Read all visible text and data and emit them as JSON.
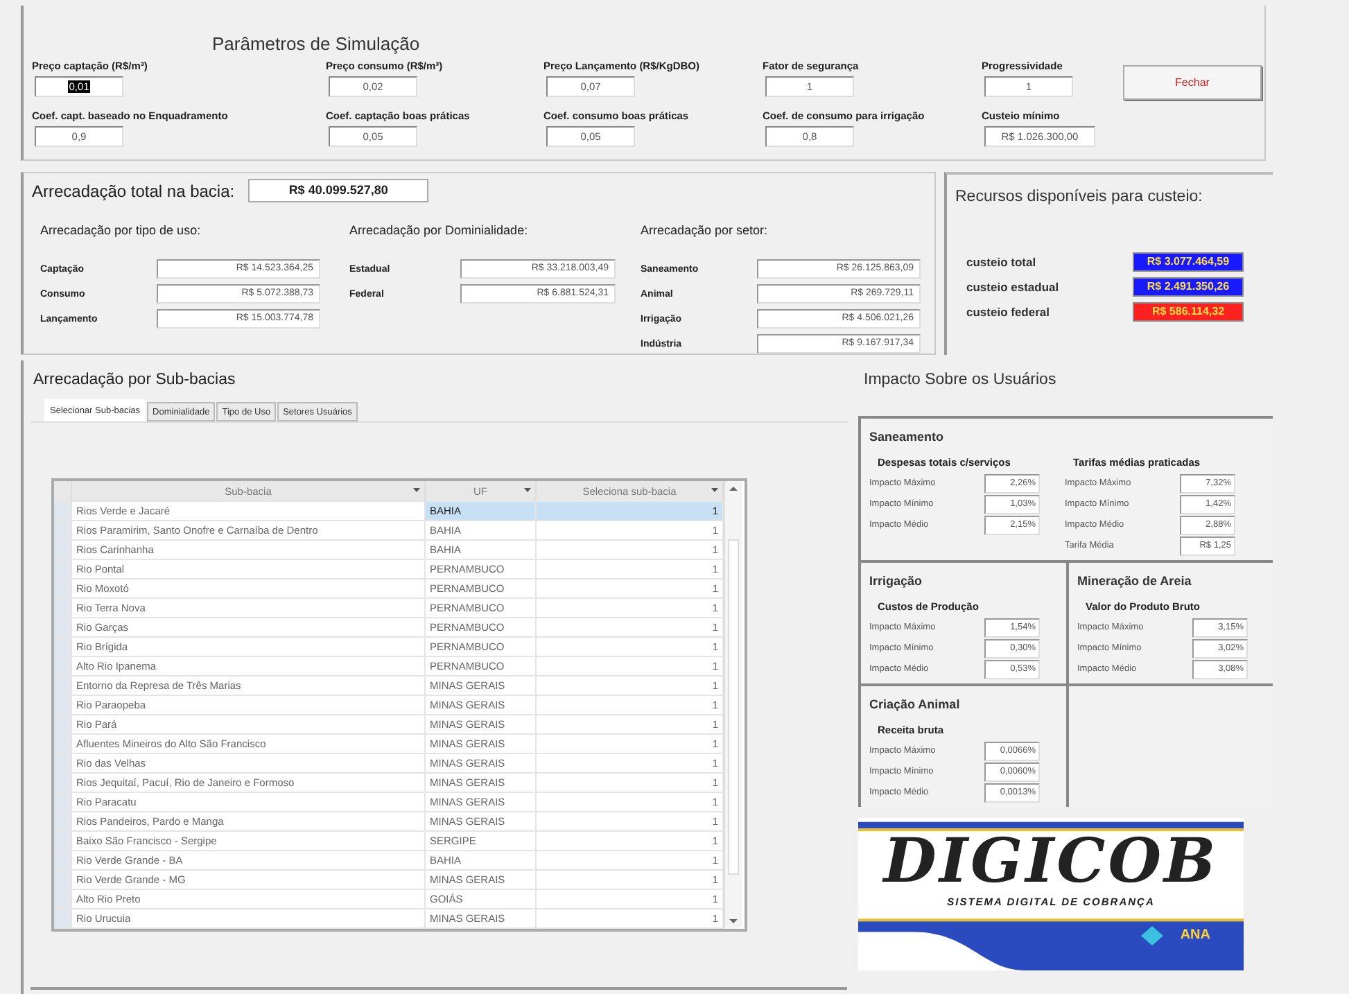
{
  "window": {
    "title": "Parâmetros de Simulação"
  },
  "parameters": [
    {
      "label": "Preço captação (R$/m³)",
      "value": "0,01",
      "highlighted": true
    },
    {
      "label": "Preço consumo (R$/m³)",
      "value": "0,02",
      "highlighted": false
    },
    {
      "label": "Preço Lançamento (R$/KgDBO)",
      "value": "0,07",
      "highlighted": false
    },
    {
      "label": "Fator de segurança",
      "value": "1",
      "highlighted": false
    },
    {
      "label": "Progressividade",
      "value": "1",
      "highlighted": false
    },
    {
      "label": "Coef. capt. baseado no Enquadramento",
      "value": "0,9",
      "highlighted": false
    },
    {
      "label": "Coef. captação boas práticas",
      "value": "0,05",
      "highlighted": false
    },
    {
      "label": "Coef. consumo boas práticas",
      "value": "0,05",
      "highlighted": false
    },
    {
      "label": "Coef. de consumo para irrigação",
      "value": "0,8",
      "highlighted": false
    },
    {
      "label": "Custeio mínimo",
      "value": "R$ 1.026.300,00",
      "highlighted": false
    }
  ],
  "close_button": "Fechar",
  "total": {
    "label": "Arrecadação total na bacia:",
    "value": "R$ 40.099.527,80"
  },
  "groups": [
    {
      "title": "Arrecadação por tipo de uso:",
      "items": [
        {
          "label": "Captação",
          "value": "R$ 14.523.364,25"
        },
        {
          "label": "Consumo",
          "value": "R$ 5.072.388,73"
        },
        {
          "label": "Lançamento",
          "value": "R$ 15.003.774,78"
        }
      ]
    },
    {
      "title": "Arrecadação por Dominialidade:",
      "items": [
        {
          "label": "Estadual",
          "value": "R$ 33.218.003,49"
        },
        {
          "label": "Federal",
          "value": "R$ 6.881.524,31"
        }
      ]
    },
    {
      "title": "Arrecadação por setor:",
      "items": [
        {
          "label": "Saneamento",
          "value": "R$ 26.125.863,09"
        },
        {
          "label": "Animal",
          "value": "R$ 269.729,11"
        },
        {
          "label": "Irrigação",
          "value": "R$ 4.506.021,26"
        },
        {
          "label": "Indústria",
          "value": "R$ 9.167.917,34"
        }
      ]
    }
  ],
  "resources": {
    "title": "Recursos disponíveis para custeio:",
    "items": [
      {
        "label": "custeio total",
        "value": "R$ 3.077.464,59",
        "color": "#1a1aff"
      },
      {
        "label": "custeio estadual",
        "value": "R$ 2.491.350,26",
        "color": "#1a1aff"
      },
      {
        "label": "custeio federal",
        "value": "R$ 586.114,32",
        "color": "#ff2020"
      }
    ]
  },
  "subbasins": {
    "title": "Arrecadação por Sub-bacias",
    "tabs": [
      {
        "label": "Selecionar Sub-bacias",
        "selected": true
      },
      {
        "label": "Dominialidade",
        "selected": false
      },
      {
        "label": "Tipo de Uso",
        "selected": false
      },
      {
        "label": "Setores Usuários",
        "selected": false
      }
    ],
    "columns": [
      "Sub-bacia",
      "UF",
      "Seleciona sub-bacia"
    ],
    "rows": [
      {
        "cells": [
          "Rios Verde e Jacaré",
          "BAHIA",
          "1"
        ],
        "selected": true
      },
      {
        "cells": [
          "Rios Paramirim, Santo Onofre e Carnaíba de Dentro",
          "BAHIA",
          "1"
        ],
        "selected": false
      },
      {
        "cells": [
          "Rios Carinhanha",
          "BAHIA",
          "1"
        ],
        "selected": false
      },
      {
        "cells": [
          "Rio Pontal",
          "PERNAMBUCO",
          "1"
        ],
        "selected": false
      },
      {
        "cells": [
          "Rio Moxotó",
          "PERNAMBUCO",
          "1"
        ],
        "selected": false
      },
      {
        "cells": [
          "Rio Terra Nova",
          "PERNAMBUCO",
          "1"
        ],
        "selected": false
      },
      {
        "cells": [
          "Rio Garças",
          "PERNAMBUCO",
          "1"
        ],
        "selected": false
      },
      {
        "cells": [
          "Rio Brígida",
          "PERNAMBUCO",
          "1"
        ],
        "selected": false
      },
      {
        "cells": [
          "Alto Rio Ipanema",
          "PERNAMBUCO",
          "1"
        ],
        "selected": false
      },
      {
        "cells": [
          "Entorno da Represa de Três Marias",
          "MINAS GERAIS",
          "1"
        ],
        "selected": false
      },
      {
        "cells": [
          "Rio Paraopeba",
          "MINAS GERAIS",
          "1"
        ],
        "selected": false
      },
      {
        "cells": [
          "Rio Pará",
          "MINAS GERAIS",
          "1"
        ],
        "selected": false
      },
      {
        "cells": [
          "Afluentes Mineiros do Alto São Francisco",
          "MINAS GERAIS",
          "1"
        ],
        "selected": false
      },
      {
        "cells": [
          "Rio das Velhas",
          "MINAS GERAIS",
          "1"
        ],
        "selected": false
      },
      {
        "cells": [
          "Rios Jequitaí, Pacuí, Rio de Janeiro e Formoso",
          "MINAS GERAIS",
          "1"
        ],
        "selected": false
      },
      {
        "cells": [
          "Rio Paracatu",
          "MINAS GERAIS",
          "1"
        ],
        "selected": false
      },
      {
        "cells": [
          "Rios Pandeiros, Pardo e Manga",
          "MINAS GERAIS",
          "1"
        ],
        "selected": false
      },
      {
        "cells": [
          "Baixo São Francisco - Sergipe",
          "SERGIPE",
          "1"
        ],
        "selected": false
      },
      {
        "cells": [
          "Rio Verde Grande - BA",
          "BAHIA",
          "1"
        ],
        "selected": false
      },
      {
        "cells": [
          "Rio Verde Grande - MG",
          "MINAS GERAIS",
          "1"
        ],
        "selected": false
      },
      {
        "cells": [
          "Alto Rio Preto",
          "GOIÁS",
          "1"
        ],
        "selected": false
      },
      {
        "cells": [
          "Rio Urucuia",
          "MINAS GERAIS",
          "1"
        ],
        "selected": false
      }
    ]
  },
  "impact": {
    "title": "Impacto Sobre os Usuários",
    "sectors": [
      {
        "title": "Saneamento",
        "subsections": [
          {
            "title": "Despesas totais c/serviços",
            "items": [
              {
                "label": "Impacto Máximo",
                "value": "2,26%"
              },
              {
                "label": "Impacto Mínimo",
                "value": "1,03%"
              },
              {
                "label": "Impacto Médio",
                "value": "2,15%"
              }
            ]
          },
          {
            "title": "Tarifas médias praticadas",
            "items": [
              {
                "label": "Impacto Máximo",
                "value": "7,32%"
              },
              {
                "label": "Impacto Mínimo",
                "value": "1,42%"
              },
              {
                "label": "Impacto Médio",
                "value": "2,88%"
              },
              {
                "label": "Tarifa Média",
                "value": "R$ 1,25"
              }
            ]
          }
        ]
      },
      {
        "title": "Irrigação",
        "subsections": [
          {
            "title": "Custos de Produção",
            "items": [
              {
                "label": "Impacto Máximo",
                "value": "1,54%"
              },
              {
                "label": "Impacto Mínimo",
                "value": "0,30%"
              },
              {
                "label": "Impacto Médio",
                "value": "0,53%"
              }
            ]
          }
        ]
      },
      {
        "title": "Mineração de Areia",
        "subsections": [
          {
            "title": "Valor do Produto Bruto",
            "items": [
              {
                "label": "Impacto Máximo",
                "value": "3,15%"
              },
              {
                "label": "Impacto Mínimo",
                "value": "3,02%"
              },
              {
                "label": "Impacto Médio",
                "value": "3,08%"
              }
            ]
          }
        ]
      },
      {
        "title": "Criação Animal",
        "subsections": [
          {
            "title": "Receita bruta",
            "items": [
              {
                "label": "Impacto Máximo",
                "value": "0,0066%"
              },
              {
                "label": "Impacto Mínimo",
                "value": "0,0060%"
              },
              {
                "label": "Impacto Médio",
                "value": "0,0013%"
              }
            ]
          }
        ]
      }
    ]
  },
  "logo": {
    "title": "DIGICOB",
    "subtitle": "SISTEMA DIGITAL DE COBRANÇA",
    "agency": "ANA"
  }
}
